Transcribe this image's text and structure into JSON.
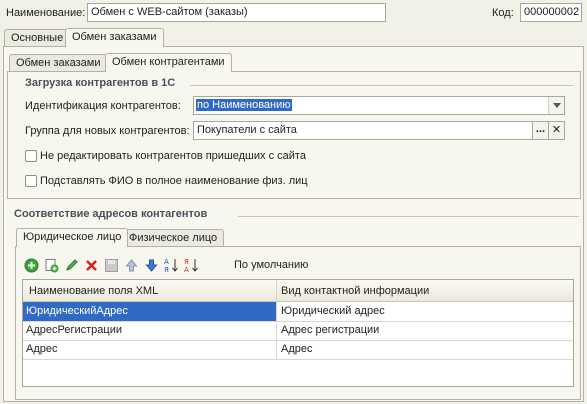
{
  "header": {
    "name_label": "Наименование:",
    "name_value": "Обмен с WEB-сайтом (заказы)",
    "code_label": "Код:",
    "code_value": "000000002"
  },
  "main_tabs": [
    {
      "label": "Основные",
      "active": false
    },
    {
      "label": "Обмен заказами",
      "active": true
    }
  ],
  "sub_tabs": [
    {
      "label": "Обмен заказами",
      "active": false
    },
    {
      "label": "Обмен контрагентами",
      "active": true
    }
  ],
  "load_section": {
    "title": "Загрузка контрагентов в 1С",
    "identification_label": "Идентификация контрагентов:",
    "identification_value": "по Наименованию",
    "group_label": "Группа для новых контрагентов:",
    "group_value": "Покупатели с сайта",
    "choose_button": "...",
    "clear_button": "✕",
    "no_edit_label": "Не редактировать контрагентов пришедших с сайта",
    "no_edit_checked": false,
    "fio_label": "Подставлять ФИО в полное наименование физ. лиц",
    "fio_checked": false
  },
  "address_section": {
    "title": "Соответствие адресов контагентов",
    "tabs": [
      {
        "label": "Юридическое лицо",
        "active": true
      },
      {
        "label": "Физическое лицо",
        "active": false
      }
    ],
    "toolbar": {
      "default_label": "По умолчанию",
      "icons": [
        "add-icon",
        "copy-icon",
        "edit-icon",
        "delete-icon",
        "save-icon",
        "move-up-icon",
        "move-down-icon",
        "sort-asc-icon",
        "sort-desc-icon"
      ]
    },
    "table": {
      "columns": [
        "Наименование поля XML",
        "Вид контактной информации"
      ],
      "rows": [
        [
          "ЮридическийАдрес",
          "Юридический адрес"
        ],
        [
          "АдресРегистрации",
          "Адрес регистрации"
        ],
        [
          "Адрес",
          "Адрес"
        ]
      ]
    }
  },
  "colors": {
    "selection": "#316ac5",
    "section_title": "#4b4f5c",
    "background": "#f2f1e8"
  }
}
